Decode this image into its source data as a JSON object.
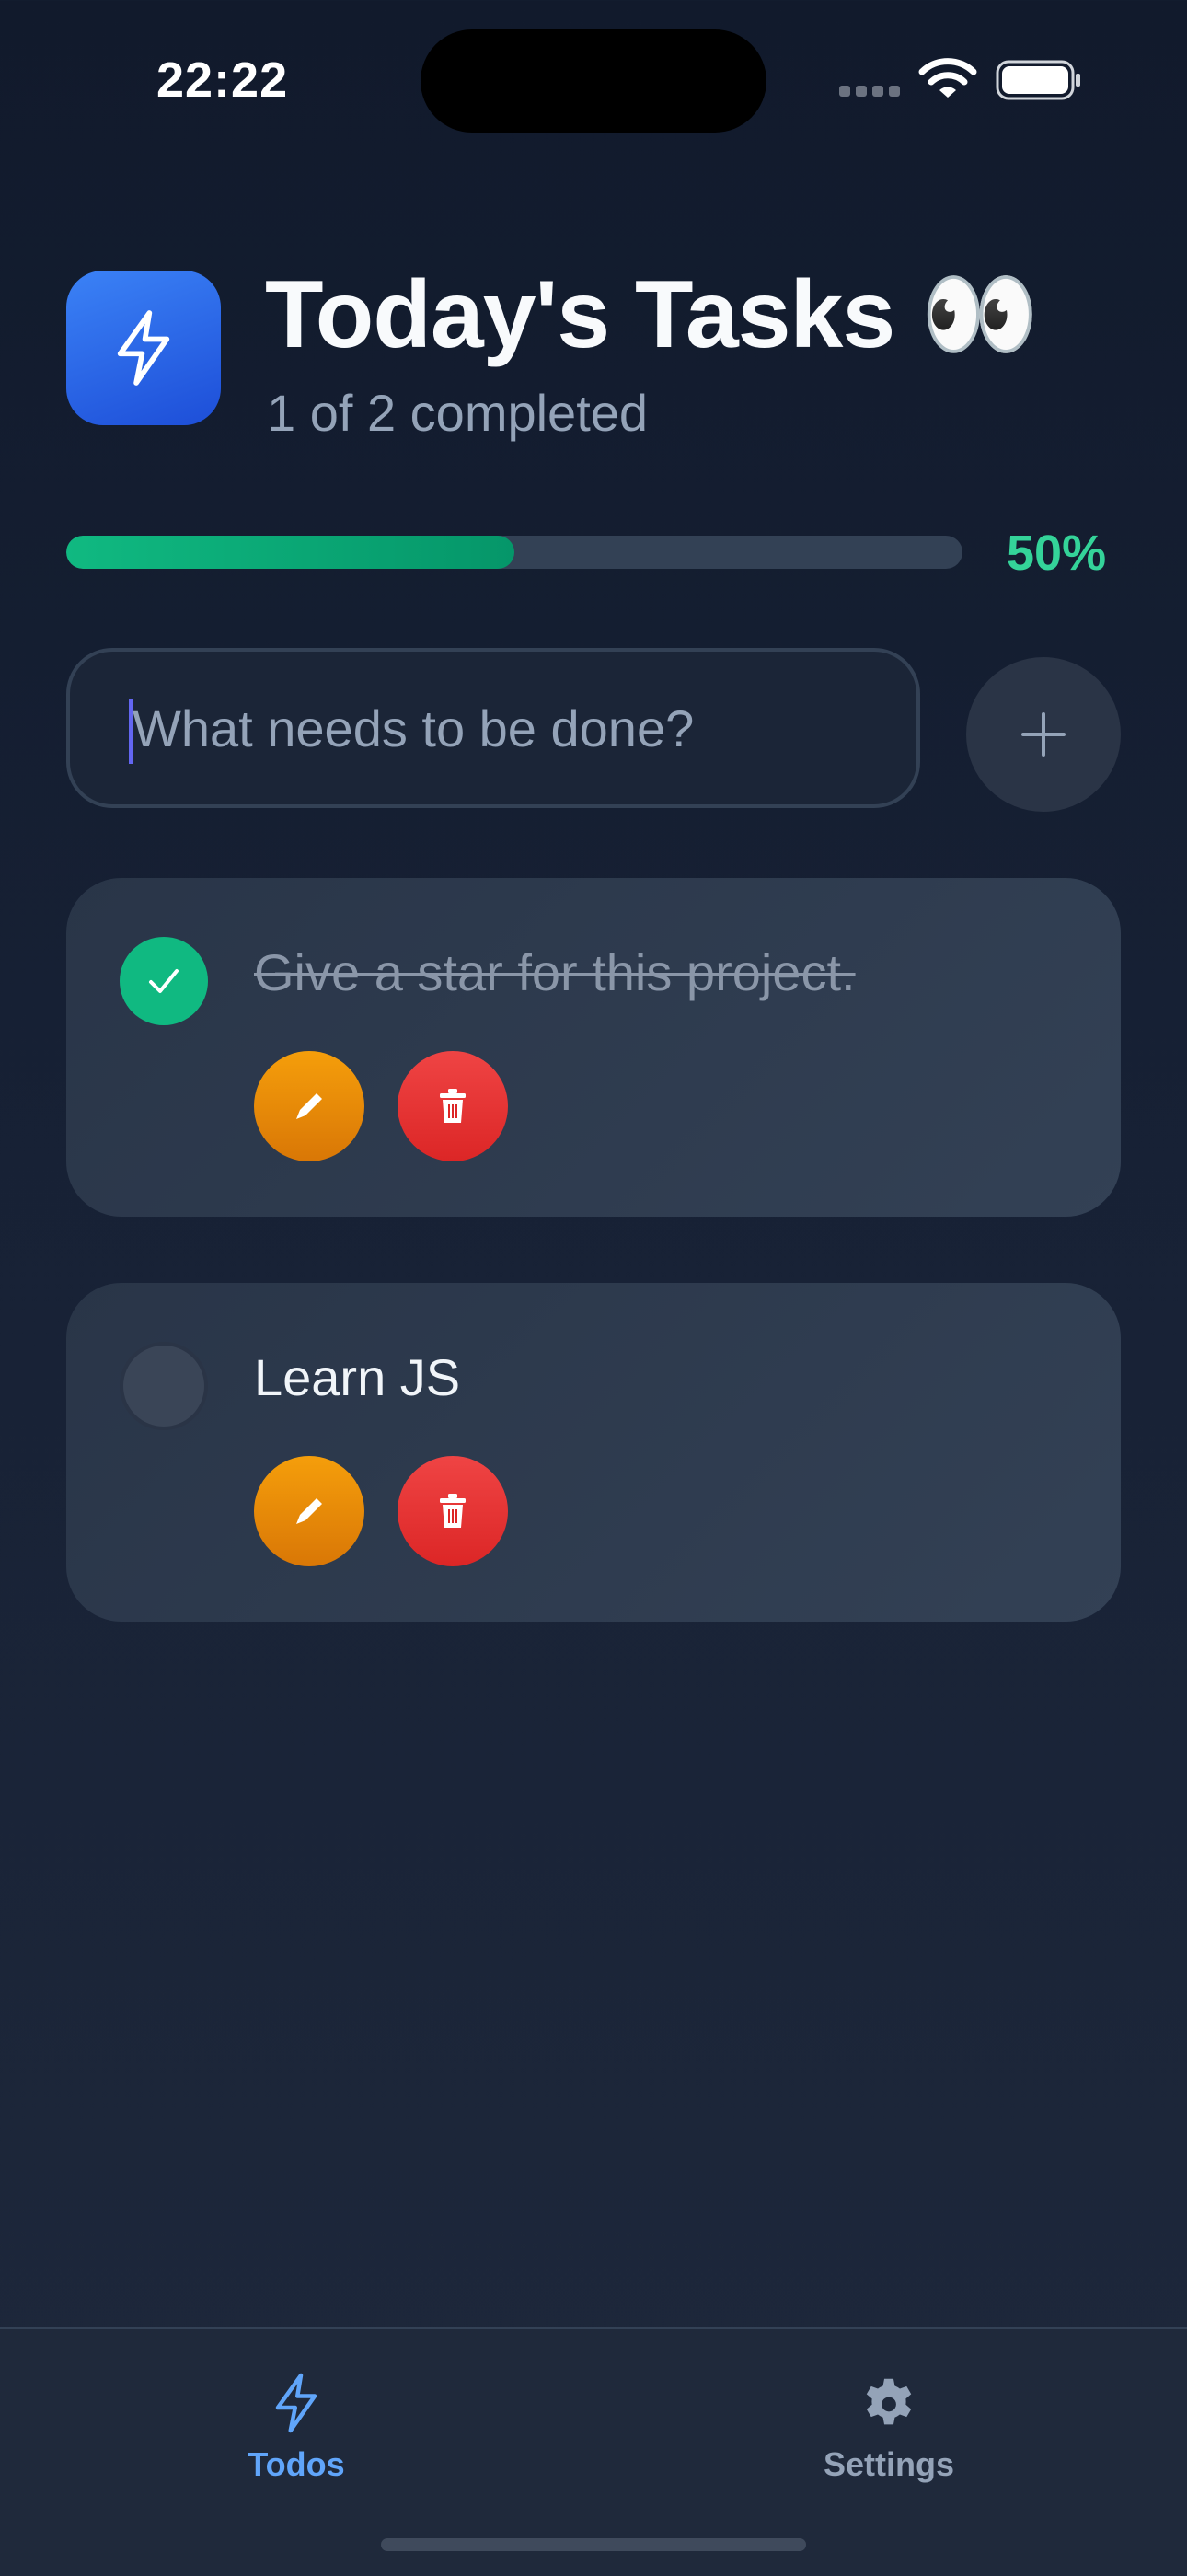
{
  "status_bar": {
    "time": "22:22"
  },
  "header": {
    "title": "Today's Tasks 👀",
    "subtitle": "1 of 2 completed"
  },
  "progress": {
    "fraction": 0.5,
    "percent_label": "50%"
  },
  "new_todo": {
    "placeholder": "What needs to be done?",
    "value": ""
  },
  "todos": [
    {
      "text": "Give a star for this project.",
      "completed": true
    },
    {
      "text": "Learn JS",
      "completed": false
    }
  ],
  "tab_bar": {
    "tabs": [
      {
        "label": "Todos",
        "icon": "bolt-icon",
        "active": true
      },
      {
        "label": "Settings",
        "icon": "gear-icon",
        "active": false
      }
    ]
  },
  "colors": {
    "accent": "#3b82f6",
    "success": "#10b981",
    "edit": "#f59e0b",
    "delete": "#ef4444",
    "tab_active": "#60a5fa",
    "tab_inactive": "#94a3b8"
  }
}
